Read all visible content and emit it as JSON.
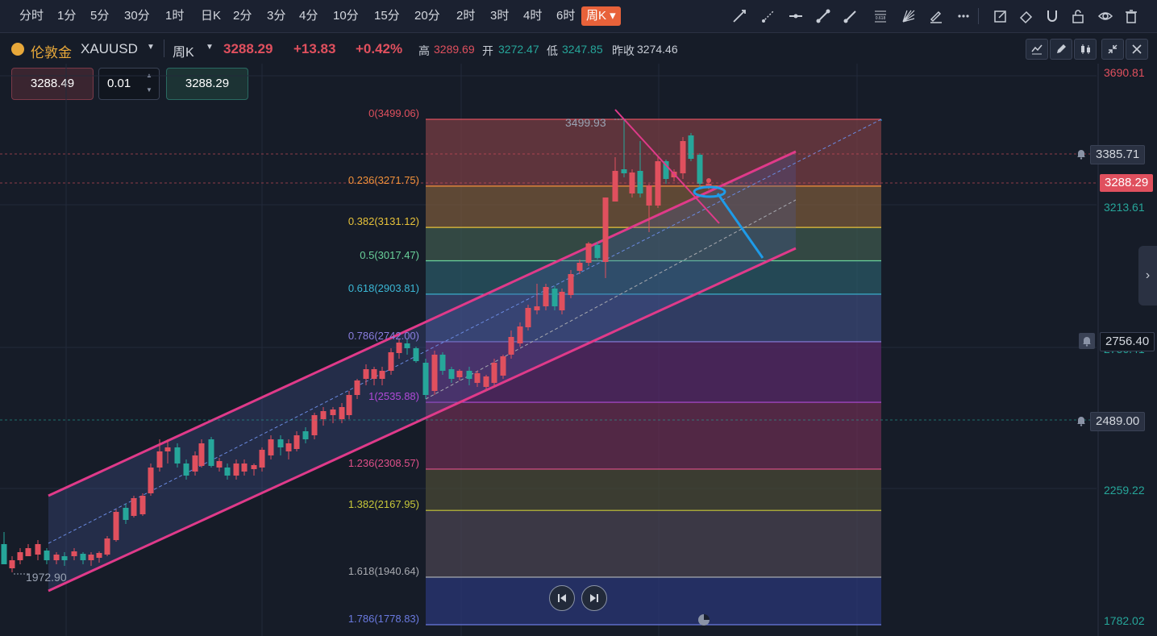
{
  "toolbar": {
    "timeframes": [
      "分时",
      "1分",
      "5分",
      "30分",
      "1时",
      "日K",
      "2分",
      "3分",
      "4分",
      "10分",
      "15分",
      "20分",
      "2时",
      "3时",
      "4时",
      "6时",
      "周K"
    ],
    "active_timeframe": "周K",
    "drawing_tools": [
      "trend-line-icon",
      "ray-icon",
      "horizontal-line-icon",
      "segment-icon",
      "arrow-line-icon",
      "fib-retracement-icon",
      "gann-fan-icon",
      "brush-icon",
      "more-icon",
      "edit-icon",
      "eraser-icon",
      "magnet-icon",
      "lock-icon",
      "eye-icon",
      "trash-icon"
    ],
    "fib_icon_text": "0.618"
  },
  "symbol": {
    "name": "伦敦金",
    "code": "XAUUSD",
    "period": "周K",
    "price": "3288.29",
    "change": "+13.83",
    "change_pct": "+0.42%",
    "high_label": "高",
    "high": "3289.69",
    "open_label": "开",
    "open": "3272.47",
    "low_label": "低",
    "low": "3247.85",
    "prev_close_label": "昨收",
    "prev_close": "3274.46"
  },
  "order": {
    "sell_price": "3288.49",
    "lot": "0.01",
    "buy_price": "3288.29"
  },
  "y_axis": {
    "labels": [
      {
        "text": "3690.81",
        "color": "#e0505e"
      },
      {
        "text": "3213.61",
        "color": "#26a69a"
      },
      {
        "text": "2756.41",
        "color": "#26a69a"
      },
      {
        "text": "2259.22",
        "color": "#26a69a"
      },
      {
        "text": "1782.02",
        "color": "#26a69a"
      }
    ],
    "current_tag": "3288.29",
    "alert_tags": [
      "3385.71",
      "2756.40",
      "2489.00"
    ]
  },
  "fib_levels": [
    {
      "ratio": "0",
      "price": "3499.06",
      "label": "0(3499.06)",
      "color": "#e0505e"
    },
    {
      "ratio": "0.236",
      "price": "3271.75",
      "label": "0.236(3271.75)",
      "color": "#f2913a"
    },
    {
      "ratio": "0.382",
      "price": "3131.12",
      "label": "0.382(3131.12)",
      "color": "#e8c33a"
    },
    {
      "ratio": "0.5",
      "price": "3017.47",
      "label": "0.5(3017.47)",
      "color": "#6ad39b"
    },
    {
      "ratio": "0.618",
      "price": "2903.81",
      "label": "0.618(2903.81)",
      "color": "#3bb8d6"
    },
    {
      "ratio": "0.786",
      "price": "2742.00",
      "label": "0.786(2742.00)",
      "color": "#8a7ee0"
    },
    {
      "ratio": "1",
      "price": "2535.88",
      "label": "1(2535.88)",
      "color": "#b04ad8"
    },
    {
      "ratio": "1.236",
      "price": "2308.57",
      "label": "1.236(2308.57)",
      "color": "#e0508a"
    },
    {
      "ratio": "1.382",
      "price": "2167.95",
      "label": "1.382(2167.95)",
      "color": "#c8c83a"
    },
    {
      "ratio": "1.618",
      "price": "1940.64",
      "label": "1.618(1940.64)",
      "color": "#a8aab0"
    },
    {
      "ratio": "1.786",
      "price": "1778.83",
      "label": "1.786(1778.83)",
      "color": "#6a7ae0"
    }
  ],
  "annotations": {
    "high_marker": "3499.93",
    "low_marker": "1972.90"
  },
  "colors": {
    "up": "#e0505e",
    "down": "#26a69a",
    "channel": "#e03a8a",
    "accent": "#e8623a",
    "projection": "#1e9be8"
  }
}
